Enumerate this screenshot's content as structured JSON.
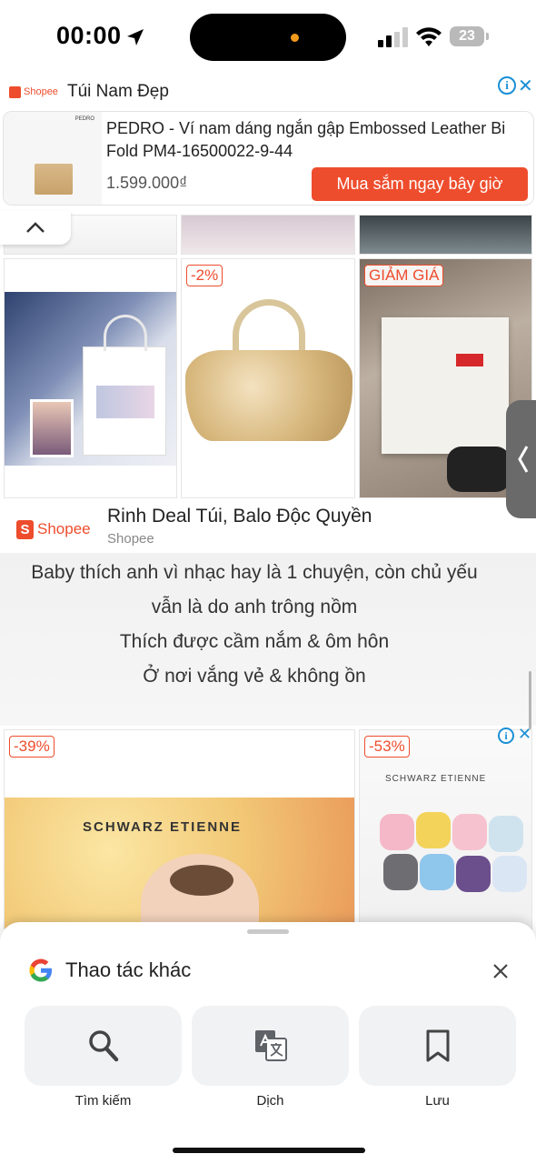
{
  "status_bar": {
    "time": "00:00",
    "battery": "23"
  },
  "ad": {
    "brand": "Shopee",
    "title": "Túi Nam Đẹp",
    "info_symbol": "i",
    "close_symbol": "✕",
    "thumb_brand": "PEDRO",
    "product_name": "PEDRO - Ví nam dáng ngắn gập Embossed Leather Bi Fold PM4-16500022-9-44",
    "price": "1.599.000₫",
    "cta": "Mua sắm ngay bây giờ"
  },
  "products_row1": [
    {
      "badge": ""
    },
    {
      "badge": "-2%"
    },
    {
      "badge": "GIẢM GIÁ"
    }
  ],
  "shopee_row": {
    "logo": "Shopee",
    "logo_symbol": "S",
    "title": "Rinh Deal Túi, Balo Độc Quyền",
    "subtitle": "Shopee"
  },
  "lyrics": [
    "Baby thích anh vì nhạc hay là 1 chuyện, còn chủ yếu",
    "vẫn là do anh trông nồm",
    "Thích được cầm nắm & ôm hôn",
    "Ở nơi vắng vẻ & không ồn"
  ],
  "products_row2": [
    {
      "badge": "-39%",
      "brand": "SCHWARZ ETIENNE"
    },
    {
      "badge": "-53%",
      "brand": "SCHWARZ ETIENNE"
    }
  ],
  "sheet": {
    "title": "Thao tác khác",
    "actions": [
      {
        "label": "Tìm kiếm",
        "icon": "search-icon"
      },
      {
        "label": "Dịch",
        "icon": "translate-icon"
      },
      {
        "label": "Lưu",
        "icon": "bookmark-icon"
      }
    ]
  },
  "colors": {
    "shopee": "#ee4d2d",
    "ad_blue": "#1a8fd6"
  }
}
